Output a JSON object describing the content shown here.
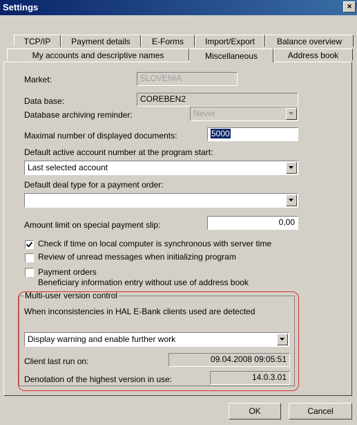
{
  "window": {
    "title": "Settings",
    "close_glyph": "×"
  },
  "tabs_row1": [
    "TCP/IP",
    "Payment details",
    "E-Forms",
    "Import/Export",
    "Balance overview"
  ],
  "tabs_row2": [
    "My accounts and descriptive names",
    "Miscellaneous",
    "Address book"
  ],
  "active_tab": "Miscellaneous",
  "market": {
    "label": "Market:",
    "value": "SLOVENIA"
  },
  "database": {
    "label": "Data base:",
    "value": "COREBEN2"
  },
  "archiving": {
    "label": "Database archiving reminder:",
    "value": "Never"
  },
  "max_docs": {
    "label": "Maximal number of displayed documents:",
    "value": "5000"
  },
  "default_account": {
    "label": "Default active account number at the program start:",
    "value": "Last selected account"
  },
  "default_deal": {
    "label": "Default deal type for a payment order:",
    "value": ""
  },
  "amount_limit": {
    "label": "Amount limit on special payment slip:",
    "value": "0,00"
  },
  "checkboxes": {
    "sync_time": {
      "label": "Check if time on local computer is synchronous with server time",
      "checked": true
    },
    "unread": {
      "label": "Review of unread messages when initializing program",
      "checked": false
    },
    "payment_orders": {
      "label": "Payment orders",
      "sublabel": "Beneficiary information entry without use of address book",
      "checked": false
    }
  },
  "multiuser": {
    "group_title": "Multi-user version control",
    "description": "When inconsistencies in HAL E-Bank clients used are detected",
    "action": "Display warning and enable further work",
    "last_run_label": "Client last run on:",
    "last_run_value": "09.04.2008 09:05:51",
    "highest_version_label": "Denotation of the highest version in use:",
    "highest_version_value": "14.0.3.01"
  },
  "buttons": {
    "ok": "OK",
    "cancel": "Cancel"
  },
  "colors": {
    "titlebar": "#0a246a",
    "dialog_bg": "#d4d0c8",
    "highlight_outline": "#d83030"
  }
}
